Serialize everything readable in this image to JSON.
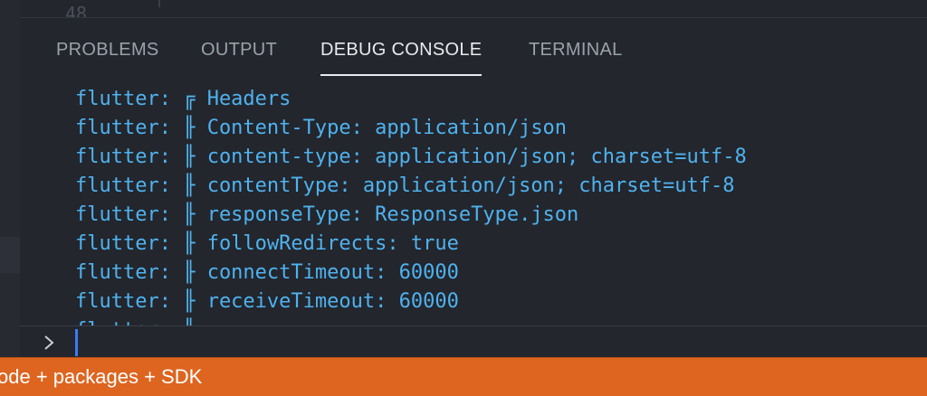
{
  "editor": {
    "ghost_line_number": "48"
  },
  "panel": {
    "tabs": [
      {
        "label": "PROBLEMS",
        "active": false
      },
      {
        "label": "OUTPUT",
        "active": false
      },
      {
        "label": "DEBUG CONSOLE",
        "active": true
      },
      {
        "label": "TERMINAL",
        "active": false
      }
    ]
  },
  "console": {
    "lines": [
      "flutter: ╔ Headers",
      "flutter: ╟ Content-Type: application/json",
      "flutter: ╟ content-type: application/json; charset=utf-8",
      "flutter: ╟ contentType: application/json; charset=utf-8",
      "flutter: ╟ responseType: ResponseType.json",
      "flutter: ╟ followRedirects: true",
      "flutter: ╟ connectTimeout: 60000",
      "flutter: ╟ receiveTimeout: 60000",
      "flutter: ║"
    ],
    "text_color": "#4fb2ee"
  },
  "input": {
    "prompt_icon": "chevron-right-icon",
    "cursor_color": "#3b7cf5"
  },
  "statusbar": {
    "text": "ode + packages + SDK",
    "background": "#dd6520"
  }
}
